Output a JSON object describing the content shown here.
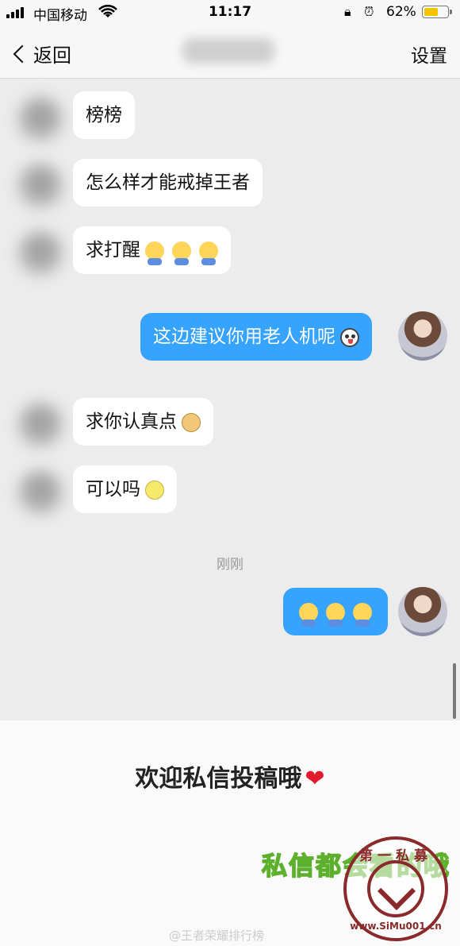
{
  "status_bar": {
    "carrier": "中国移动",
    "time": "11:17",
    "battery": "62%",
    "battery_level": 0.62
  },
  "nav": {
    "back_label": "返回",
    "settings_label": "设置"
  },
  "messages": {
    "m1": "榜榜",
    "m2": "怎么样才能戒掉王者",
    "m3": "求打醒",
    "m4": "这边建议你用老人机呢",
    "m5": "求你认真点",
    "m6": "可以吗",
    "timestamp": "刚刚"
  },
  "footer": {
    "welcome": "欢迎私信投稿哦",
    "green_caption": "私信都会看的哦",
    "weibo_handle": "@王者荣耀排行榜",
    "seal_top": "第一私募",
    "seal_bottom": "www.SiMu001.cn"
  }
}
